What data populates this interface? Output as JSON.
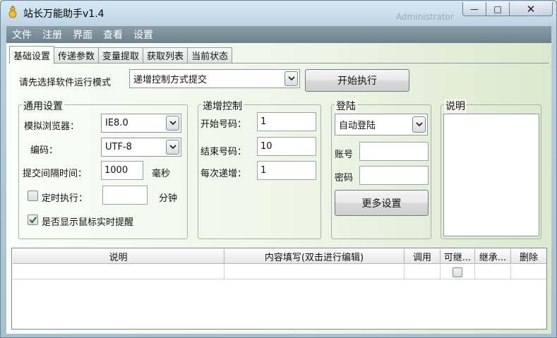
{
  "window": {
    "title": "站长万能助手v1.4",
    "background_hint": "Administrator",
    "controls": {
      "minimize": "—",
      "maximize": "□",
      "close": "✕"
    }
  },
  "menu": [
    "文件",
    "注册",
    "界面",
    "查看",
    "设置"
  ],
  "tabs": [
    {
      "label": "基础设置",
      "active": true
    },
    {
      "label": "传递参数",
      "active": false
    },
    {
      "label": "变量提取",
      "active": false
    },
    {
      "label": "获取列表",
      "active": false
    },
    {
      "label": "当前状态",
      "active": false
    }
  ],
  "mode": {
    "label": "请先选择软件运行模式",
    "selected": "递增控制方式提交",
    "start_button": "开始执行"
  },
  "general": {
    "title": "通用设置",
    "browser_label": "模拟浏览器：",
    "browser_value": "IE8.0",
    "encoding_label": "编码：",
    "encoding_value": "UTF-8",
    "interval_label": "提交间隔时间：",
    "interval_value": "1000",
    "interval_unit": "毫秒",
    "timer_label": "定时执行：",
    "timer_value": "",
    "timer_unit": "分钟",
    "timer_checked": false,
    "mouse_tip_label": "是否显示鼠标实时提醒",
    "mouse_tip_checked": true
  },
  "increment": {
    "title": "递增控制",
    "start_label": "开始号码：",
    "start_value": "1",
    "end_label": "结束号码：",
    "end_value": "10",
    "step_label": "每次递增：",
    "step_value": "1"
  },
  "login": {
    "title": "登陆",
    "mode_value": "自动登陆",
    "account_label": "账号",
    "account_value": "",
    "password_label": "密码",
    "password_value": "",
    "more_button": "更多设置"
  },
  "description": {
    "title": "说明",
    "text": ""
  },
  "grid": {
    "columns": [
      "说明",
      "内容填写(双击进行编辑)",
      "调用",
      "可继...",
      "继承...",
      "删除"
    ],
    "rows": [
      {
        "cells": [
          "",
          "",
          "",
          "",
          "",
          ""
        ],
        "inheritable_checked": false
      }
    ]
  },
  "colors": {
    "menubar": "#7b8f99",
    "client_bg": "#eef5e6",
    "check_mark": "#22aa55"
  },
  "icons": {
    "app": "gourd-icon",
    "dropdown": "chevron-down-icon",
    "check": "check-icon"
  }
}
